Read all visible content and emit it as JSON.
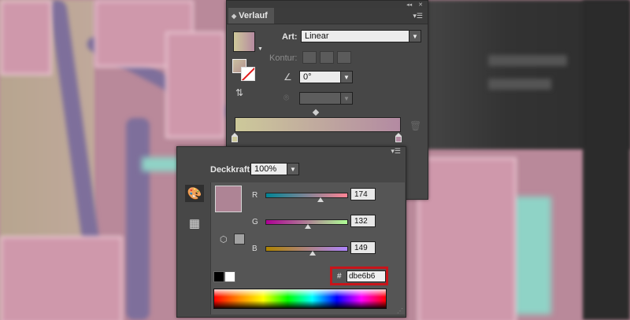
{
  "gradient_panel": {
    "tab_title": "Verlauf",
    "art_label": "Art:",
    "art_value": "Linear",
    "kontur_label": "Kontur:",
    "angle_value": "0°"
  },
  "color_panel": {
    "opacity_label": "Deckkraft:",
    "opacity_value": "100%",
    "r_label": "R",
    "r_value": "174",
    "g_label": "G",
    "g_value": "132",
    "b_label": "B",
    "b_value": "149",
    "r_fraction": 0.68,
    "g_fraction": 0.52,
    "b_fraction": 0.58,
    "hash": "#",
    "hex_value": "dbe6b6"
  },
  "colors": {
    "current_color": "#ae8495",
    "gradient_start": "#cdc99a",
    "gradient_end": "#b38aa2",
    "highlight": "#c8141a"
  }
}
